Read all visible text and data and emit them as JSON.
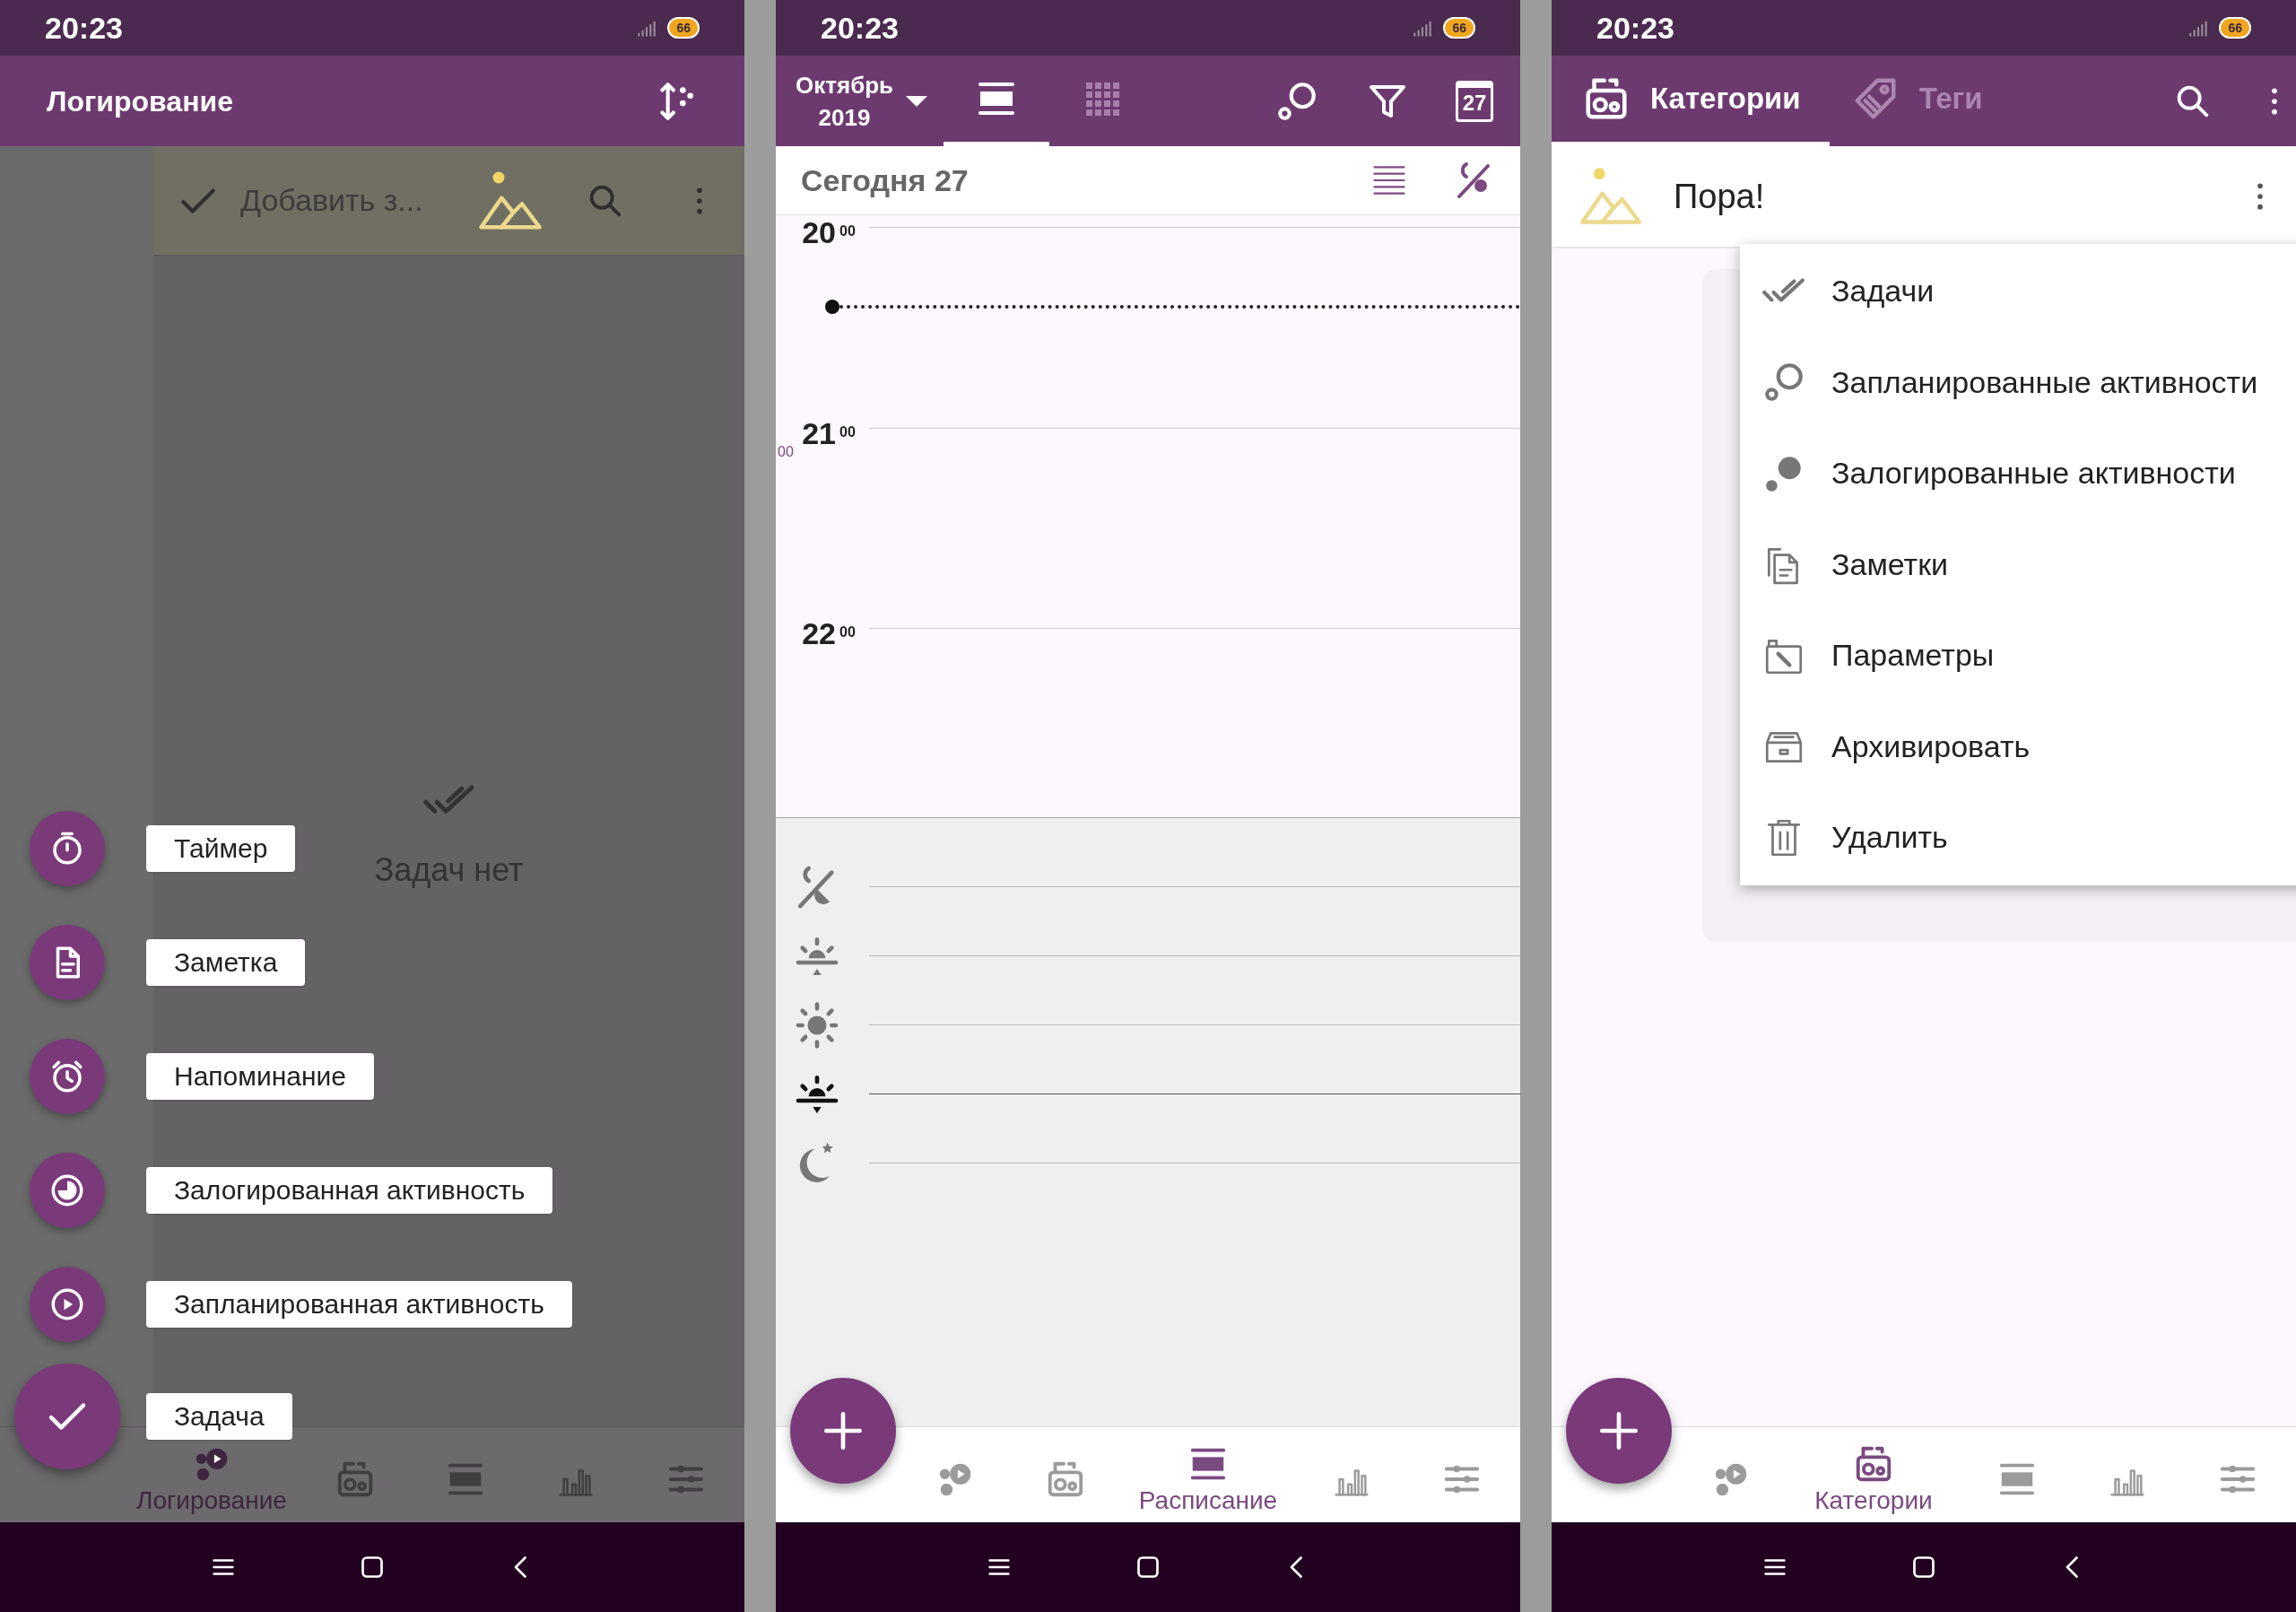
{
  "screens": [
    {
      "kind": "logging",
      "status_bar": {
        "time": "20:23",
        "battery": "66"
      },
      "app_bar": {
        "title": "Логирование"
      },
      "add_field": {
        "placeholder": "Добавить з..."
      },
      "empty_state": "Задач нет",
      "fab_menu": [
        {
          "kind": "timer",
          "label": "Таймер"
        },
        {
          "kind": "note",
          "label": "Заметка"
        },
        {
          "kind": "reminder",
          "label": "Напоминание"
        },
        {
          "kind": "logged",
          "label": "Залогированная активность"
        },
        {
          "kind": "planned",
          "label": "Запланированная активность"
        },
        {
          "kind": "task",
          "label": "Задача"
        }
      ],
      "bottom_nav": [
        {
          "kind": "logging",
          "label": "Логирование",
          "selected": true
        },
        {
          "kind": "categories",
          "selected": false
        },
        {
          "kind": "schedule",
          "selected": false
        },
        {
          "kind": "stats",
          "selected": false
        },
        {
          "kind": "settings",
          "selected": false
        }
      ]
    },
    {
      "kind": "schedule",
      "status_bar": {
        "time": "20:23",
        "battery": "66"
      },
      "app_bar": {
        "month": "Октябрь",
        "year": "2019",
        "view_tabs": [
          {
            "kind": "list",
            "selected": true
          },
          {
            "kind": "grid",
            "selected": false
          }
        ],
        "calendar_day": "27"
      },
      "day_header": "Сегодня 27",
      "hours": [
        {
          "hour": "20",
          "minutes": "00"
        },
        {
          "hour": "21",
          "minutes": "00"
        },
        {
          "hour": "22",
          "minutes": "00"
        }
      ],
      "time_marker": "00",
      "bottom_nav": [
        {
          "kind": "logging",
          "selected": false
        },
        {
          "kind": "categories",
          "selected": false
        },
        {
          "kind": "schedule",
          "label": "Расписание",
          "selected": true
        },
        {
          "kind": "stats",
          "selected": false
        },
        {
          "kind": "settings",
          "selected": false
        }
      ]
    },
    {
      "kind": "categories",
      "status_bar": {
        "time": "20:23",
        "battery": "66"
      },
      "tabs": [
        {
          "kind": "categories",
          "label": "Категории",
          "selected": true
        },
        {
          "kind": "tags",
          "label": "Теги",
          "selected": false
        }
      ],
      "category": {
        "name": "Пора!"
      },
      "menu": [
        {
          "kind": "tasks",
          "label": "Задачи"
        },
        {
          "kind": "planned",
          "label": "Запланированные активности"
        },
        {
          "kind": "logged",
          "label": "Залогированные активности"
        },
        {
          "kind": "notes",
          "label": "Заметки"
        },
        {
          "kind": "params",
          "label": "Параметры"
        },
        {
          "kind": "archive",
          "label": "Архивировать"
        },
        {
          "kind": "delete",
          "label": "Удалить"
        }
      ],
      "bottom_nav": [
        {
          "kind": "logging",
          "selected": false
        },
        {
          "kind": "categories",
          "label": "Категории",
          "selected": true
        },
        {
          "kind": "schedule",
          "selected": false
        },
        {
          "kind": "stats",
          "selected": false
        },
        {
          "kind": "settings",
          "selected": false
        }
      ]
    }
  ]
}
